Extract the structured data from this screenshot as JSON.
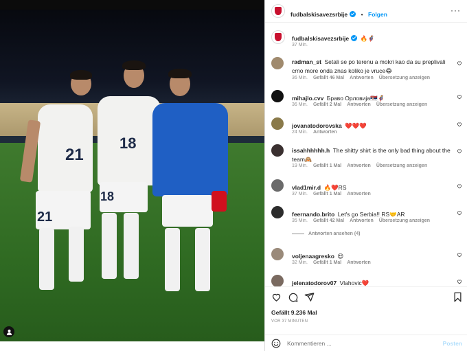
{
  "post": {
    "account": "fudbalskisavezsrbije",
    "follow_label": "Folgen",
    "more_icon": "more-horizontal-icon",
    "caption_emojis": "🔥🦸",
    "caption_time": "37 Min."
  },
  "comments": [
    {
      "user": "radman_st",
      "text": "Setali se po terenu a mokri kao da su preplivali crno more onda znas koliko je vruce😂",
      "time": "36 Min.",
      "likes": "Gefällt 46 Mal",
      "reply": "Antworten",
      "translate": "Übersetzung anzeigen"
    },
    {
      "user": "mihajlo.cvv",
      "text": "Браво Орловија🇷🇸🦸",
      "time": "36 Min.",
      "likes": "Gefällt 2 Mal",
      "reply": "Antworten",
      "translate": "Übersetzung anzeigen"
    },
    {
      "user": "jovanatodorovska",
      "text": "❤️❤️❤️",
      "time": "24 Min.",
      "likes": "",
      "reply": "Antworten",
      "translate": ""
    },
    {
      "user": "issahhhhhh.h",
      "text": "The shitty shirt is the only bad thing about the team🙈",
      "time": "19 Min.",
      "likes": "Gefällt 1 Mal",
      "reply": "Antworten",
      "translate": "Übersetzung anzeigen"
    },
    {
      "user": "vlad1mir.d",
      "text": "🔥❤️RS",
      "time": "37 Min.",
      "likes": "Gefällt 1 Mal",
      "reply": "Antworten",
      "translate": ""
    },
    {
      "user": "feernando.brito",
      "text": "Let's go Serbia!! RS🤝AR",
      "time": "35 Min.",
      "likes": "Gefällt 42 Mal",
      "reply": "Antworten",
      "translate": "Übersetzung anzeigen"
    },
    {
      "user": "voljenaagresko",
      "text": "😍",
      "time": "32 Min.",
      "likes": "Gefällt 1 Mal",
      "reply": "Antworten",
      "translate": ""
    },
    {
      "user": "jelenatodorov07",
      "text": "Vlahovic❤️",
      "time": "",
      "likes": "",
      "reply": "",
      "translate": ""
    }
  ],
  "view_replies": "Antworten ansehen (4)",
  "likes_total": "Gefällt 9.236 Mal",
  "posted_ago": "VOR 37 MINUTEN",
  "composer": {
    "placeholder": "Kommentieren ...",
    "post_label": "Posten"
  },
  "colors": {
    "accent": "#0095f6",
    "heart": "#ed4956",
    "muted": "#8e8e8e"
  }
}
